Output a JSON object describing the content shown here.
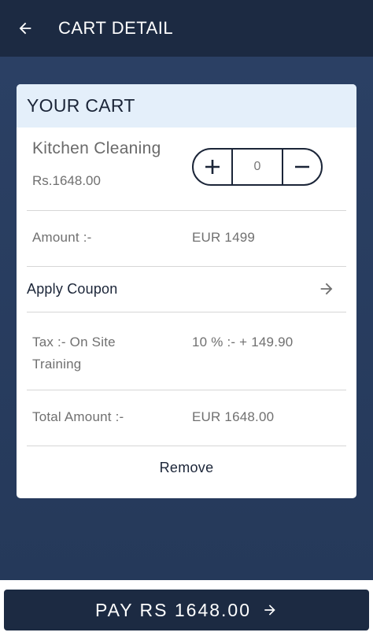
{
  "appbar": {
    "title": "CART DETAIL",
    "back_icon": "arrow-left-icon"
  },
  "card": {
    "header": "YOUR CART",
    "item": {
      "name": "Kitchen Cleaning",
      "price": "Rs.1648.00",
      "quantity": "0",
      "plus_icon": "plus-icon",
      "minus_icon": "minus-icon"
    },
    "amount": {
      "label": "Amount :-",
      "value": "EUR 1499"
    },
    "coupon": {
      "label": "Apply Coupon",
      "icon": "arrow-right-icon"
    },
    "tax": {
      "label": "Tax :- On Site Training",
      "value": "10 % :- + 149.90"
    },
    "total": {
      "label": "Total Amount :-",
      "value": "EUR 1648.00"
    },
    "remove_label": "Remove"
  },
  "pay_button": {
    "label": "PAY RS 1648.00",
    "icon": "arrow-right-icon"
  },
  "colors": {
    "appbar": "#1c2a42",
    "background": "#2a3f5f",
    "card_header": "#e4effa",
    "pay_button": "#1c2a42"
  }
}
